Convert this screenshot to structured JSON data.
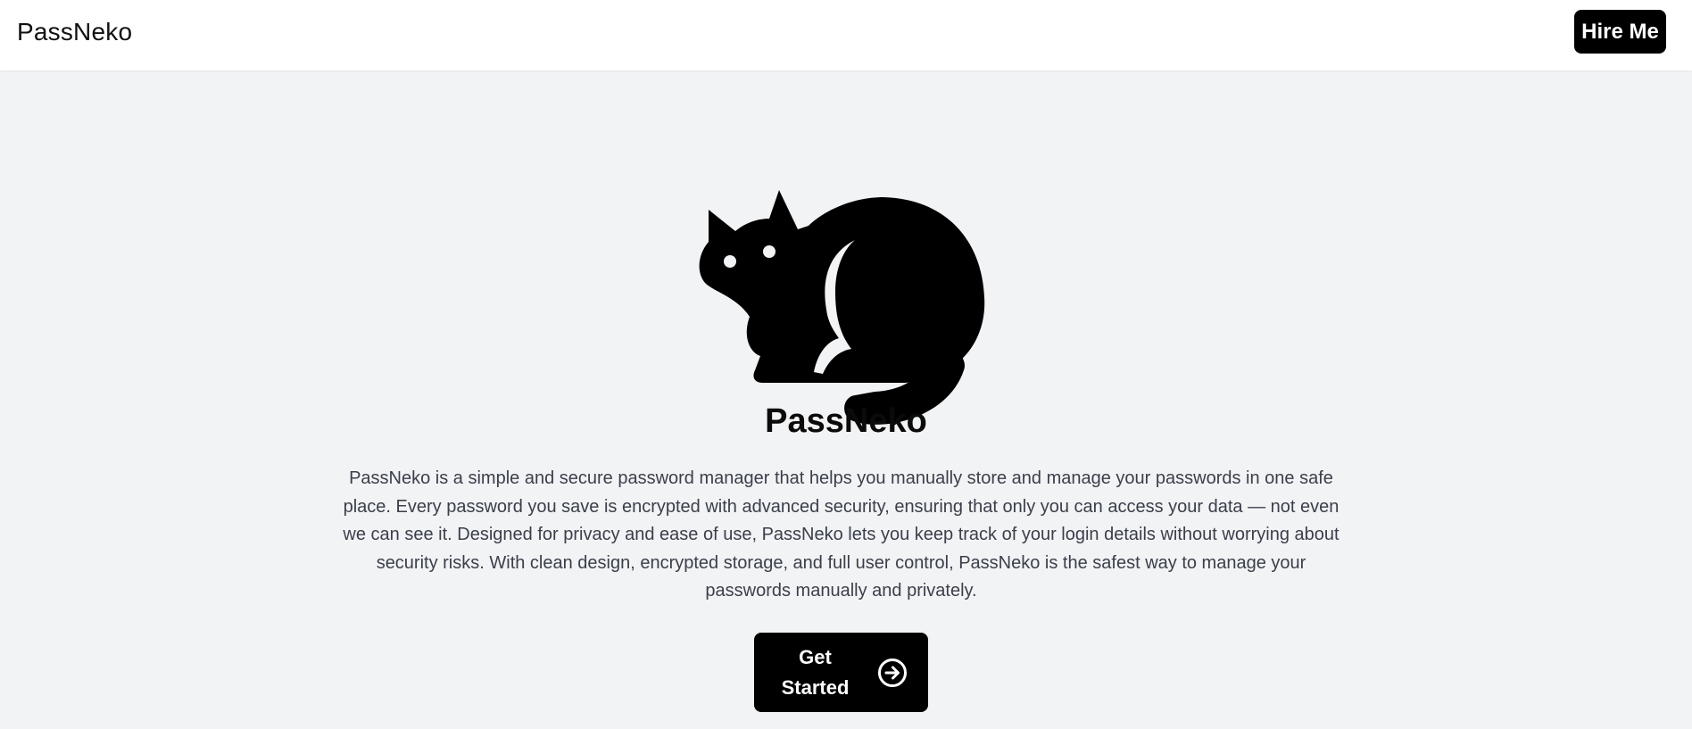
{
  "navbar": {
    "brand": "PassNeko",
    "hire_label": "Hire Me"
  },
  "hero": {
    "logo_icon": "cat-icon",
    "title": "PassNeko",
    "description": "PassNeko is a simple and secure password manager that helps you manually store and manage your passwords in one safe place. Every password you save is encrypted with advanced security, ensuring that only you can access your data — not even we can see it. Designed for privacy and ease of use, PassNeko lets you keep track of your login details without worrying about security risks. With clean design, encrypted storage, and full user control, PassNeko is the safest way to manage your passwords manually and privately.",
    "cta_label": "Get Started",
    "cta_icon": "arrow-right-circle-icon"
  },
  "colors": {
    "page_background": "#f2f3f5",
    "navbar_background": "#ffffff",
    "button_background": "#000000",
    "button_text": "#ffffff",
    "description_text": "#3a3f4a"
  }
}
